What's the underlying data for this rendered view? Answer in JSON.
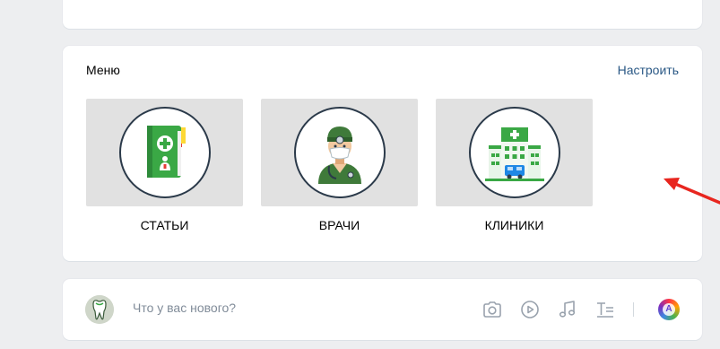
{
  "menu": {
    "title": "Меню",
    "settings_label": "Настроить",
    "items": [
      {
        "label": "СТАТЬИ",
        "icon": "medical-book-icon"
      },
      {
        "label": "ВРАЧИ",
        "icon": "doctor-icon"
      },
      {
        "label": "КЛИНИКИ",
        "icon": "clinic-building-icon"
      }
    ]
  },
  "post": {
    "placeholder": "Что у вас нового?",
    "author_initial": "A",
    "icons": [
      "camera-icon",
      "video-icon",
      "music-icon",
      "text-format-icon",
      "author-avatar"
    ]
  },
  "annotation": {
    "arrow_color": "#e8261f"
  },
  "colors": {
    "link": "#2a5885",
    "tile_bg": "#e1e1e1",
    "page_bg": "#edeef0",
    "green_accent": "#3aa845"
  }
}
